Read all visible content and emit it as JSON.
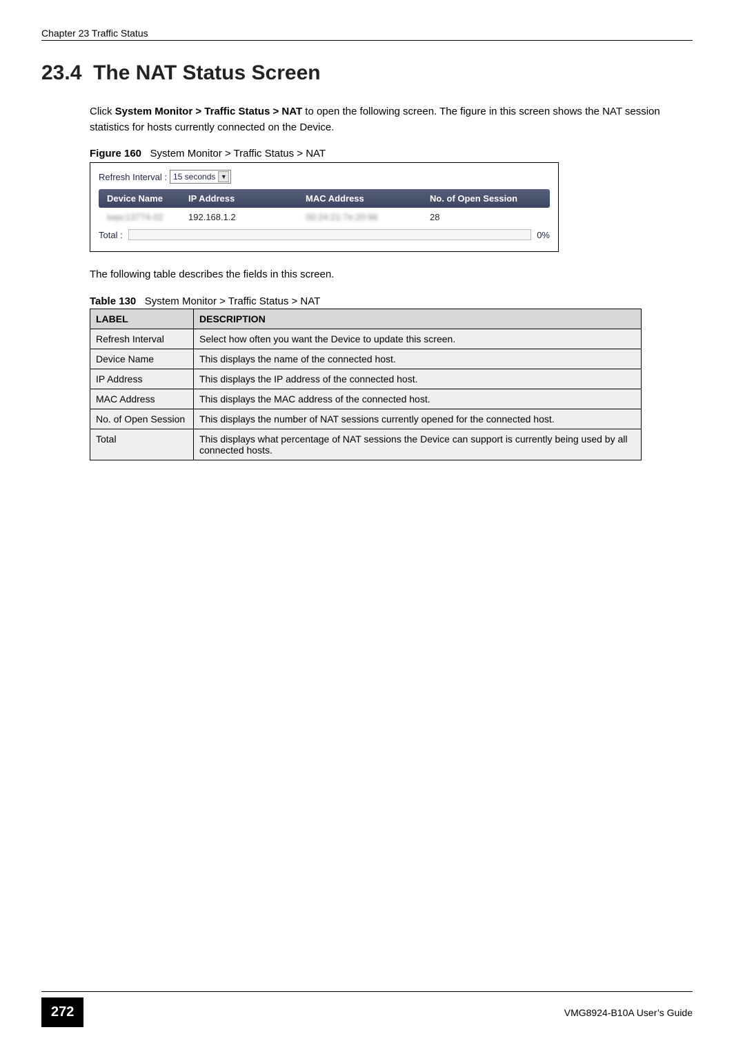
{
  "header": {
    "chapter_title": "Chapter 23 Traffic Status"
  },
  "section": {
    "number": "23.4",
    "title": "The NAT Status Screen"
  },
  "intro": {
    "prefix": "Click ",
    "bold_path": "System Monitor > Traffic Status > NAT",
    "suffix": " to open the following screen. The figure in this screen shows the NAT session statistics for hosts currently connected on the Device."
  },
  "figure": {
    "label": "Figure 160",
    "caption": "System Monitor > Traffic Status > NAT",
    "refresh_label": "Refresh Interval :",
    "refresh_value": "15 seconds",
    "columns": {
      "device_name": "Device Name",
      "ip_address": "IP Address",
      "mac_address": "MAC Address",
      "open_session": "No. of Open Session"
    },
    "row": {
      "device_name": "twpc13774-02",
      "ip_address": "192.168.1.2",
      "mac_address": "00:24:21:7e:20:96",
      "open_session": "28"
    },
    "total_label": "Total :",
    "total_pct": "0%"
  },
  "after_figure_text": "The following table describes the fields in this screen.",
  "table": {
    "label": "Table 130",
    "caption": "System Monitor > Traffic Status > NAT",
    "headers": {
      "label": "LABEL",
      "description": "DESCRIPTION"
    },
    "rows": [
      {
        "label": "Refresh Interval",
        "desc": "Select how often you want the Device to update this screen."
      },
      {
        "label": "Device Name",
        "desc": "This displays the name of the connected host."
      },
      {
        "label": "IP Address",
        "desc": "This displays the IP address of the connected host."
      },
      {
        "label": "MAC Address",
        "desc": "This displays the MAC address of the connected host."
      },
      {
        "label": "No. of Open Session",
        "desc": "This displays the number of  NAT sessions currently opened for the connected host."
      },
      {
        "label": "Total",
        "desc": "This displays what percentage of NAT sessions the Device can support is currently being used by all connected hosts."
      }
    ]
  },
  "footer": {
    "page_number": "272",
    "guide_title": "VMG8924-B10A User’s Guide"
  }
}
